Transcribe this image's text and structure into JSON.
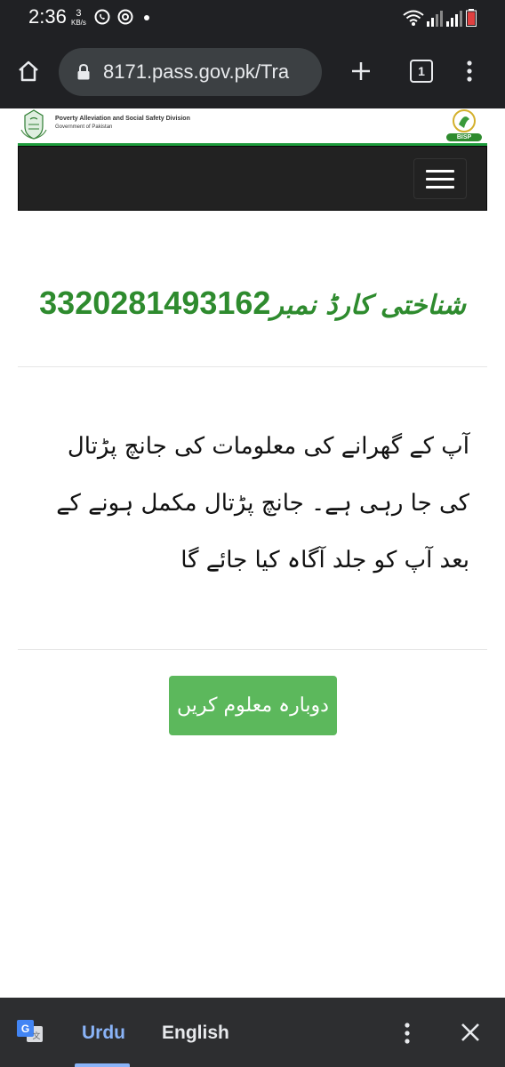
{
  "status_bar": {
    "time": "2:36",
    "speed_value": "3",
    "speed_unit": "KB/s"
  },
  "browser": {
    "url": "8171.pass.gov.pk/Tra",
    "tab_count": "1"
  },
  "site_header": {
    "division_title": "Poverty Alleviation and Social Safety Division",
    "division_subtitle": "Government of Pakistan",
    "logo_text": "BISP"
  },
  "content": {
    "cnic_label": "شناختی کارڈ نمبر",
    "cnic_number": "3320281493162",
    "message": "آپ کے گھرانے کی معلومات کی جانچ پڑتال کی جا رہی ہے۔ جانچ پڑتال مکمل ہونے کے بعد آپ کو جلد آگاہ کیا جائے گا",
    "retry_label": "دوبارہ معلوم کریں"
  },
  "translate_bar": {
    "tab_source": "Urdu",
    "tab_target": "English"
  },
  "colors": {
    "accent_green": "#2e8b2e",
    "button_green": "#5cb85c",
    "navbar": "#222222",
    "translate_active": "#8ab4f8"
  }
}
